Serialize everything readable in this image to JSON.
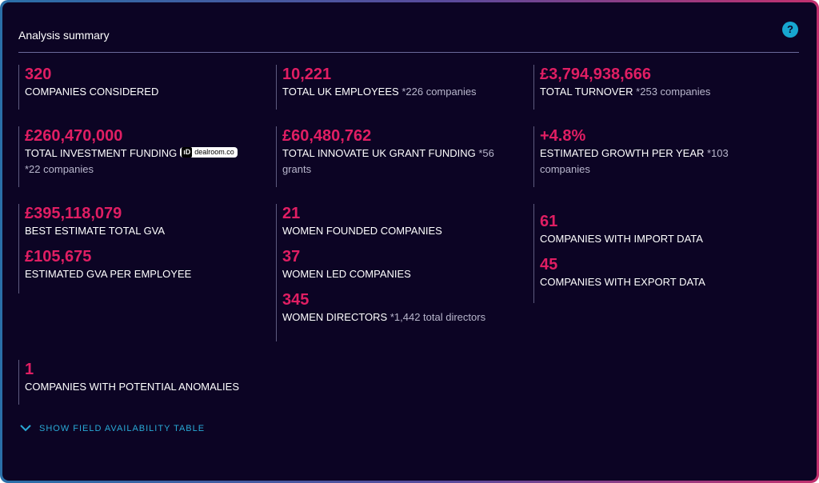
{
  "panel": {
    "title": "Analysis summary",
    "help_glyph": "?",
    "toggle_label": "SHOW FIELD AVAILABILITY TABLE"
  },
  "stats": {
    "companies_considered": {
      "value": "320",
      "label": "COMPANIES CONSIDERED"
    },
    "uk_employees": {
      "value": "10,221",
      "label": "TOTAL UK EMPLOYEES",
      "note": "*226 companies"
    },
    "turnover": {
      "value": "£3,794,938,666",
      "label": "TOTAL TURNOVER",
      "note": "*253 companies"
    },
    "investment": {
      "value": "£260,470,000",
      "label": "TOTAL INVESTMENT FUNDING",
      "badge_mark": "ıD",
      "badge_text": "dealroom.co",
      "note": "*22 companies"
    },
    "innovate_grant": {
      "value": "£60,480,762",
      "label": "TOTAL INNOVATE UK GRANT FUNDING",
      "note": "*56 grants"
    },
    "growth": {
      "value": "+4.8%",
      "label": "ESTIMATED GROWTH PER YEAR",
      "note": "*103 companies"
    },
    "gva_total": {
      "value": "£395,118,079",
      "label": "BEST ESTIMATE TOTAL GVA"
    },
    "gva_employee": {
      "value": "£105,675",
      "label": "ESTIMATED GVA PER EMPLOYEE"
    },
    "women_founded": {
      "value": "21",
      "label": "WOMEN FOUNDED COMPANIES"
    },
    "women_led": {
      "value": "37",
      "label": "WOMEN LED COMPANIES"
    },
    "women_directors": {
      "value": "345",
      "label": "WOMEN DIRECTORS",
      "note": "*1,442 total directors"
    },
    "import_data": {
      "value": "61",
      "label": "COMPANIES WITH IMPORT DATA"
    },
    "export_data": {
      "value": "45",
      "label": "COMPANIES WITH EXPORT DATA"
    },
    "anomalies": {
      "value": "1",
      "label": "COMPANIES WITH POTENTIAL ANOMALIES"
    }
  },
  "colors": {
    "accent_value": "#e01e63",
    "link": "#29a9d6",
    "background": "#0c0424"
  }
}
